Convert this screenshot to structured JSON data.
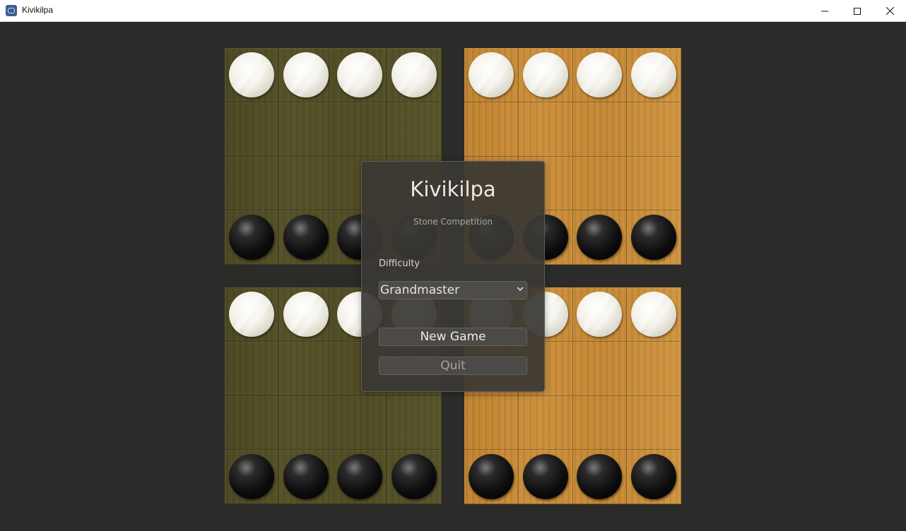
{
  "window": {
    "title": "Kivikilpa",
    "app_icon": "godot-engine-icon",
    "controls": [
      "minimize-icon",
      "maximize-icon",
      "close-icon"
    ]
  },
  "boards": [
    {
      "id": "top-left",
      "theme": "dark-olive-wood",
      "rows": [
        [
          "white",
          "white",
          "white",
          "white"
        ],
        [
          "",
          "",
          "",
          ""
        ],
        [
          "",
          "",
          "",
          ""
        ],
        [
          "black",
          "black",
          "black",
          "black"
        ]
      ]
    },
    {
      "id": "top-right",
      "theme": "light-wood",
      "rows": [
        [
          "white",
          "white",
          "white",
          "white"
        ],
        [
          "",
          "",
          "",
          ""
        ],
        [
          "",
          "",
          "",
          ""
        ],
        [
          "black",
          "black",
          "black",
          "black"
        ]
      ]
    },
    {
      "id": "bottom-left",
      "theme": "dark-olive-wood",
      "rows": [
        [
          "white",
          "white",
          "white",
          "white"
        ],
        [
          "",
          "",
          "",
          ""
        ],
        [
          "",
          "",
          "",
          ""
        ],
        [
          "black",
          "black",
          "black",
          "black"
        ]
      ]
    },
    {
      "id": "bottom-right",
      "theme": "light-wood",
      "rows": [
        [
          "white",
          "white",
          "white",
          "white"
        ],
        [
          "",
          "",
          "",
          ""
        ],
        [
          "",
          "",
          "",
          ""
        ],
        [
          "black",
          "black",
          "black",
          "black"
        ]
      ]
    }
  ],
  "menu": {
    "title": "Kivikilpa",
    "subtitle": "Stone Competition",
    "difficulty_label": "Difficulty",
    "difficulty_selected": "Grandmaster",
    "new_game_label": "New Game",
    "quit_label": "Quit"
  },
  "colors": {
    "background": "#2b2b29",
    "dark_board": "#4f4b23",
    "light_board": "#c48733",
    "dialog": "#3a3834"
  }
}
